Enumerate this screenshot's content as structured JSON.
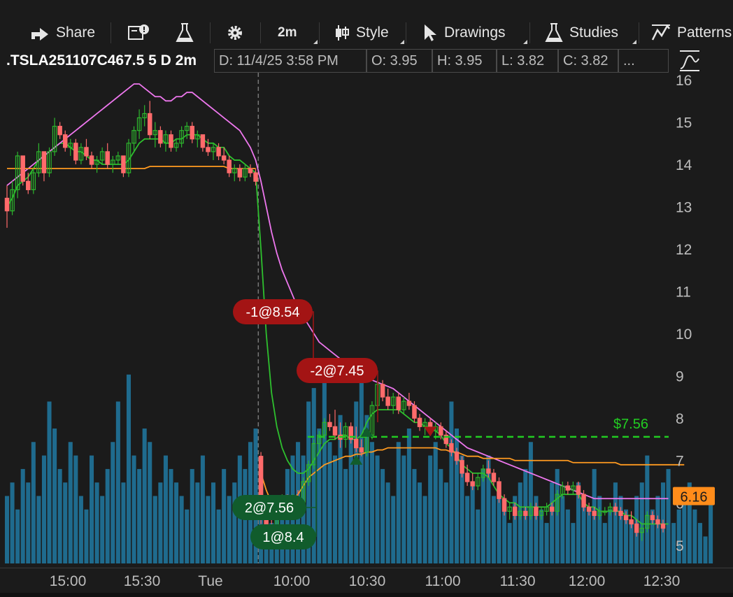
{
  "toolbar": {
    "share": "Share",
    "timeframe": "2m",
    "style": "Style",
    "drawings": "Drawings",
    "studies": "Studies",
    "patterns": "Patterns",
    "icons": [
      "share-icon",
      "news-icon",
      "flask-icon",
      "gear-icon",
      "candlestick-icon",
      "cursor-icon",
      "studies-flask-icon",
      "patterns-icon",
      "style-curve-icon"
    ]
  },
  "info": {
    "symbol": ".TSLA251107C467.5 5 D 2m",
    "date": "D: 11/4/25 3:58 PM",
    "open": "O: 3.95",
    "high": "H: 3.95",
    "low": "L: 3.82",
    "close": "C: 3.82",
    "more": "..."
  },
  "chart_data": {
    "type": "candlestick",
    "title": ".TSLA251107C467.5 5 D 2m",
    "ylim": [
      4.6,
      16.1
    ],
    "yticks": [
      16,
      15,
      14,
      13,
      12,
      11,
      10,
      9,
      8,
      7,
      6,
      5
    ],
    "xticks": [
      "15:00",
      "15:30",
      "Tue",
      "10:00",
      "10:30",
      "11:00",
      "11:30",
      "12:00",
      "12:30"
    ],
    "last_price": "6.16",
    "price_line": {
      "label": "$7.56",
      "value": 7.56
    },
    "orders": [
      {
        "label": "-1@8.54",
        "side": "sell",
        "price": 8.54
      },
      {
        "label": "-2@7.45",
        "side": "sell",
        "price": 7.45
      },
      {
        "label": "2@7.56",
        "side": "buy",
        "price": 7.56
      },
      {
        "label": "1@8.4",
        "side": "buy",
        "price": 8.4
      }
    ],
    "candles": [
      [
        13.2,
        13.5,
        12.5,
        12.9
      ],
      [
        12.9,
        13.6,
        12.8,
        13.4
      ],
      [
        13.4,
        14.3,
        13.2,
        14.2
      ],
      [
        14.2,
        14.1,
        13.5,
        13.6
      ],
      [
        13.6,
        13.8,
        13.3,
        13.4
      ],
      [
        13.4,
        13.9,
        13.3,
        13.8
      ],
      [
        13.8,
        14.5,
        13.7,
        14.3
      ],
      [
        14.3,
        14.0,
        13.6,
        13.8
      ],
      [
        13.8,
        14.4,
        13.7,
        14.3
      ],
      [
        14.3,
        15.1,
        14.2,
        14.9
      ],
      [
        14.9,
        15.0,
        14.6,
        14.7
      ],
      [
        14.7,
        14.8,
        14.3,
        14.4
      ],
      [
        14.4,
        14.6,
        14.2,
        14.5
      ],
      [
        14.5,
        14.6,
        14.0,
        14.1
      ],
      [
        14.1,
        14.5,
        14.0,
        14.4
      ],
      [
        14.4,
        14.6,
        14.1,
        14.2
      ],
      [
        14.2,
        14.3,
        13.9,
        14.0
      ],
      [
        14.0,
        14.2,
        13.8,
        14.1
      ],
      [
        14.1,
        14.4,
        14.0,
        14.3
      ],
      [
        14.3,
        14.5,
        13.9,
        14.0
      ],
      [
        14.0,
        14.2,
        13.8,
        14.1
      ],
      [
        14.1,
        14.3,
        14.0,
        14.2
      ],
      [
        14.2,
        14.2,
        13.7,
        13.8
      ],
      [
        13.8,
        14.6,
        13.7,
        14.5
      ],
      [
        14.5,
        14.9,
        14.3,
        14.8
      ],
      [
        14.8,
        15.3,
        14.6,
        15.1
      ],
      [
        15.1,
        15.4,
        14.9,
        15.2
      ],
      [
        15.2,
        15.5,
        14.6,
        14.7
      ],
      [
        14.7,
        15.0,
        14.4,
        14.8
      ],
      [
        14.8,
        14.9,
        14.4,
        14.5
      ],
      [
        14.5,
        14.8,
        14.3,
        14.7
      ],
      [
        14.7,
        14.8,
        14.3,
        14.4
      ],
      [
        14.4,
        14.6,
        14.3,
        14.5
      ],
      [
        14.5,
        14.9,
        14.4,
        14.8
      ],
      [
        14.8,
        15.0,
        14.6,
        14.9
      ],
      [
        14.9,
        15.0,
        14.5,
        14.6
      ],
      [
        14.6,
        14.8,
        14.4,
        14.7
      ],
      [
        14.7,
        14.7,
        14.3,
        14.4
      ],
      [
        14.4,
        14.6,
        14.2,
        14.3
      ],
      [
        14.3,
        14.5,
        14.1,
        14.4
      ],
      [
        14.4,
        14.5,
        14.1,
        14.2
      ],
      [
        14.2,
        14.4,
        14.0,
        14.1
      ],
      [
        14.1,
        14.2,
        13.7,
        13.8
      ],
      [
        13.8,
        14.0,
        13.6,
        13.9
      ],
      [
        13.9,
        14.0,
        13.6,
        13.7
      ],
      [
        13.7,
        14.0,
        13.6,
        13.9
      ],
      [
        13.9,
        14.0,
        13.7,
        13.8
      ],
      [
        13.8,
        13.9,
        13.5,
        13.6
      ],
      [
        7.1,
        7.2,
        5.5,
        5.7
      ],
      [
        5.7,
        6.0,
        5.1,
        5.3
      ],
      [
        5.3,
        5.6,
        5.0,
        5.1
      ],
      [
        5.1,
        5.8,
        5.0,
        5.7
      ],
      [
        5.7,
        6.2,
        5.6,
        6.1
      ],
      [
        6.1,
        6.2,
        5.7,
        5.8
      ],
      [
        5.8,
        6.2,
        5.7,
        6.1
      ],
      [
        6.1,
        6.3,
        5.9,
        6.0
      ],
      [
        6.0,
        6.6,
        5.9,
        6.5
      ],
      [
        6.5,
        7.0,
        6.4,
        6.9
      ],
      [
        6.9,
        7.5,
        6.8,
        7.4
      ],
      [
        7.4,
        7.7,
        7.2,
        7.6
      ],
      [
        7.6,
        8.0,
        7.5,
        7.9
      ],
      [
        7.9,
        8.1,
        7.7,
        7.8
      ],
      [
        7.8,
        8.2,
        7.5,
        7.6
      ],
      [
        7.6,
        7.9,
        7.3,
        7.5
      ],
      [
        7.5,
        7.9,
        7.3,
        7.8
      ],
      [
        7.8,
        7.9,
        7.4,
        7.5
      ],
      [
        7.5,
        7.8,
        7.2,
        7.3
      ],
      [
        7.3,
        7.5,
        7.1,
        7.2
      ],
      [
        7.2,
        7.7,
        7.1,
        7.6
      ],
      [
        7.6,
        8.4,
        7.5,
        8.3
      ],
      [
        8.3,
        8.9,
        8.2,
        8.8
      ],
      [
        8.8,
        8.9,
        8.4,
        8.5
      ],
      [
        8.5,
        8.7,
        8.2,
        8.3
      ],
      [
        8.3,
        8.6,
        8.1,
        8.5
      ],
      [
        8.5,
        8.6,
        8.1,
        8.2
      ],
      [
        8.2,
        8.5,
        8.1,
        8.4
      ],
      [
        8.4,
        8.6,
        8.2,
        8.3
      ],
      [
        8.3,
        8.4,
        7.9,
        8.0
      ],
      [
        8.0,
        8.1,
        7.7,
        7.8
      ],
      [
        7.8,
        8.0,
        7.6,
        7.9
      ],
      [
        7.9,
        8.0,
        7.6,
        7.7
      ],
      [
        7.7,
        7.9,
        7.5,
        7.8
      ],
      [
        7.8,
        7.9,
        7.5,
        7.6
      ],
      [
        7.6,
        7.7,
        7.3,
        7.4
      ],
      [
        7.4,
        7.5,
        7.1,
        7.2
      ],
      [
        7.2,
        7.3,
        6.9,
        7.0
      ],
      [
        7.0,
        7.1,
        6.6,
        6.7
      ],
      [
        6.7,
        6.9,
        6.4,
        6.5
      ],
      [
        6.5,
        6.7,
        6.3,
        6.4
      ],
      [
        6.4,
        6.7,
        6.3,
        6.6
      ],
      [
        6.6,
        6.9,
        6.5,
        6.8
      ],
      [
        6.8,
        7.0,
        6.6,
        6.7
      ],
      [
        6.7,
        6.8,
        6.4,
        6.5
      ],
      [
        6.5,
        6.6,
        6.0,
        6.1
      ],
      [
        6.1,
        6.2,
        5.7,
        5.8
      ],
      [
        5.8,
        6.0,
        5.6,
        5.9
      ],
      [
        5.9,
        6.0,
        5.6,
        5.7
      ],
      [
        5.7,
        5.9,
        5.6,
        5.8
      ],
      [
        5.8,
        5.9,
        5.6,
        5.7
      ],
      [
        5.7,
        6.0,
        5.6,
        5.9
      ],
      [
        5.9,
        6.0,
        5.6,
        5.7
      ],
      [
        5.7,
        5.9,
        5.6,
        5.8
      ],
      [
        5.8,
        6.0,
        5.7,
        5.9
      ],
      [
        5.9,
        6.0,
        5.7,
        5.8
      ],
      [
        5.8,
        6.3,
        5.7,
        6.2
      ],
      [
        6.2,
        6.5,
        6.1,
        6.4
      ],
      [
        6.4,
        6.5,
        6.2,
        6.3
      ],
      [
        6.3,
        6.5,
        6.2,
        6.4
      ],
      [
        6.4,
        6.5,
        6.1,
        6.2
      ],
      [
        6.2,
        6.3,
        5.8,
        5.9
      ],
      [
        5.9,
        6.0,
        5.7,
        5.8
      ],
      [
        5.8,
        5.9,
        5.6,
        5.7
      ],
      [
        5.7,
        5.9,
        5.6,
        5.8
      ],
      [
        5.8,
        5.9,
        5.7,
        5.8
      ],
      [
        5.8,
        6.0,
        5.7,
        5.9
      ],
      [
        5.9,
        6.0,
        5.7,
        5.8
      ],
      [
        5.8,
        5.9,
        5.6,
        5.7
      ],
      [
        5.7,
        5.8,
        5.5,
        5.6
      ],
      [
        5.6,
        5.8,
        5.4,
        5.5
      ],
      [
        5.5,
        5.6,
        5.2,
        5.3
      ],
      [
        5.3,
        5.5,
        5.1,
        5.4
      ],
      [
        5.4,
        5.8,
        5.3,
        5.7
      ],
      [
        5.7,
        5.8,
        5.5,
        5.6
      ],
      [
        5.6,
        5.7,
        5.4,
        5.5
      ],
      [
        5.5,
        5.6,
        5.3,
        5.4
      ]
    ],
    "volume": [
      5,
      6,
      4,
      7,
      6,
      9,
      5,
      8,
      12,
      10,
      7,
      6,
      9,
      8,
      5,
      4,
      8,
      6,
      5,
      7,
      9,
      12,
      6,
      14,
      8,
      7,
      10,
      9,
      5,
      6,
      8,
      7,
      6,
      5,
      4,
      7,
      6,
      8,
      5,
      6,
      4,
      7,
      5,
      6,
      8,
      7,
      9,
      10,
      6,
      4,
      3,
      5,
      4,
      7,
      8,
      9,
      8,
      12,
      13,
      10,
      14,
      9,
      8,
      11,
      7,
      10,
      12,
      15,
      11,
      9,
      8,
      7,
      6,
      5,
      9,
      8,
      10,
      7,
      6,
      5,
      8,
      9,
      7,
      6,
      12,
      10,
      8,
      5,
      6,
      4,
      7,
      8,
      5,
      6,
      4,
      3,
      5,
      6,
      7,
      9,
      5,
      4,
      3,
      6,
      7,
      5,
      4,
      3,
      6,
      5,
      4,
      7,
      5,
      3,
      4,
      6,
      5,
      4,
      3,
      5,
      6,
      8,
      4,
      5,
      6,
      7,
      3,
      4,
      5,
      6,
      4,
      3,
      2,
      5
    ],
    "series": [
      {
        "kind": "ema-fast",
        "values": [
          13.0,
          13.2,
          13.5,
          13.6,
          13.7,
          13.9,
          14.1,
          14.2,
          14.3,
          14.4,
          14.5,
          14.5,
          14.4,
          14.3,
          14.3,
          14.2,
          14.1,
          14.1,
          14.0,
          14.0,
          14.0,
          14.0,
          14.0,
          14.1,
          14.3,
          14.5,
          14.6,
          14.6,
          14.6,
          14.6,
          14.5,
          14.5,
          14.6,
          14.6,
          14.7,
          14.7,
          14.7,
          14.6,
          14.5,
          14.5,
          14.4,
          14.4,
          14.2,
          14.1,
          14.1,
          14.0,
          13.9,
          13.8,
          12.0,
          10.0,
          8.6,
          7.8,
          7.3,
          7.0,
          6.8,
          6.7,
          6.7,
          6.8,
          7.0,
          7.2,
          7.4,
          7.5,
          7.5,
          7.6,
          7.6,
          7.5,
          7.5,
          7.6,
          7.9,
          8.1,
          8.2,
          8.2,
          8.2,
          8.2,
          8.2,
          8.1,
          8.0,
          7.9,
          7.9,
          7.8,
          7.8,
          7.7,
          7.6,
          7.4,
          7.3,
          7.1,
          6.9,
          6.8,
          6.7,
          6.7,
          6.7,
          6.6,
          6.4,
          6.2,
          6.1,
          6.0,
          6.0,
          5.9,
          5.9,
          5.9,
          5.9,
          5.9,
          5.9,
          6.0,
          6.1,
          6.2,
          6.2,
          6.2,
          6.2,
          6.0,
          5.9,
          5.9,
          5.8,
          5.8,
          5.8,
          5.8,
          5.8,
          5.7,
          5.7,
          5.6,
          5.5,
          5.5,
          5.5,
          5.5,
          5.5,
          5.5
        ]
      },
      {
        "kind": "ema-slow",
        "values": [
          13.5,
          13.6,
          13.7,
          13.8,
          13.9,
          14.0,
          14.1,
          14.2,
          14.3,
          14.4,
          14.5,
          14.6,
          14.7,
          14.8,
          14.9,
          15.0,
          15.1,
          15.2,
          15.3,
          15.4,
          15.5,
          15.6,
          15.7,
          15.8,
          15.9,
          15.9,
          15.8,
          15.7,
          15.6,
          15.6,
          15.5,
          15.5,
          15.6,
          15.6,
          15.7,
          15.7,
          15.6,
          15.5,
          15.4,
          15.3,
          15.2,
          15.1,
          15.0,
          14.9,
          14.8,
          14.6,
          14.4,
          14.1,
          13.6,
          13.0,
          12.4,
          11.9,
          11.5,
          11.2,
          10.9,
          10.6,
          10.4,
          10.2,
          10.0,
          9.8,
          9.7,
          9.6,
          9.5,
          9.4,
          9.3,
          9.2,
          9.1,
          9.0,
          8.95,
          8.9,
          8.85,
          8.8,
          8.75,
          8.7,
          8.6,
          8.5,
          8.4,
          8.3,
          8.2,
          8.1,
          8.0,
          7.9,
          7.8,
          7.7,
          7.6,
          7.5,
          7.4,
          7.3,
          7.25,
          7.2,
          7.15,
          7.1,
          7.05,
          7.0,
          6.95,
          6.9,
          6.85,
          6.8,
          6.75,
          6.7,
          6.65,
          6.6,
          6.55,
          6.5,
          6.45,
          6.4,
          6.35,
          6.3,
          6.25,
          6.2,
          6.15,
          6.1,
          6.1,
          6.1,
          6.1,
          6.1,
          6.1,
          6.1,
          6.1,
          6.1,
          6.1,
          6.1,
          6.1,
          6.1,
          6.1,
          6.1
        ]
      },
      {
        "kind": "vwap",
        "values": [
          13.9,
          13.9,
          13.9,
          13.9,
          13.9,
          13.9,
          13.9,
          13.9,
          13.9,
          13.9,
          13.9,
          13.9,
          13.9,
          13.9,
          13.9,
          13.9,
          13.9,
          13.9,
          13.9,
          13.9,
          13.9,
          13.9,
          13.9,
          13.9,
          13.9,
          13.9,
          13.9,
          13.95,
          13.95,
          13.95,
          13.95,
          13.95,
          13.95,
          13.95,
          13.95,
          13.95,
          13.95,
          13.95,
          13.95,
          13.95,
          13.95,
          13.95,
          13.9,
          13.9,
          13.9,
          13.9,
          13.9,
          13.9,
          6.7,
          6.3,
          6.0,
          5.95,
          5.95,
          6.0,
          6.1,
          6.2,
          6.4,
          6.6,
          6.7,
          6.8,
          6.9,
          6.95,
          7.0,
          7.05,
          7.1,
          7.1,
          7.15,
          7.15,
          7.2,
          7.2,
          7.25,
          7.25,
          7.3,
          7.3,
          7.3,
          7.3,
          7.3,
          7.3,
          7.3,
          7.3,
          7.3,
          7.3,
          7.25,
          7.25,
          7.2,
          7.2,
          7.15,
          7.1,
          7.1,
          7.1,
          7.05,
          7.05,
          7.05,
          7.05,
          7.05,
          7.05,
          7.0,
          7.0,
          7.0,
          7.0,
          7.0,
          7.0,
          7.0,
          7.0,
          7.0,
          7.0,
          7.0,
          6.95,
          6.95,
          6.95,
          6.95,
          6.95,
          6.95,
          6.95,
          6.95,
          6.95,
          6.9,
          6.9,
          6.9,
          6.9,
          6.9,
          6.9,
          6.9,
          6.9,
          6.9,
          6.9,
          6.9,
          6.9,
          6.9
        ]
      }
    ],
    "colors": {
      "up": "#2db52d",
      "down": "#ff6b6b",
      "volume": "#1f6b8e",
      "ema-fast": "#2ec02e",
      "ema-slow": "#ee77ee",
      "vwap": "#ff9a20",
      "sell": "#a31414",
      "buy": "#115c2c",
      "price_line": "#22cc22",
      "last_price": "#ff8c1a"
    }
  }
}
